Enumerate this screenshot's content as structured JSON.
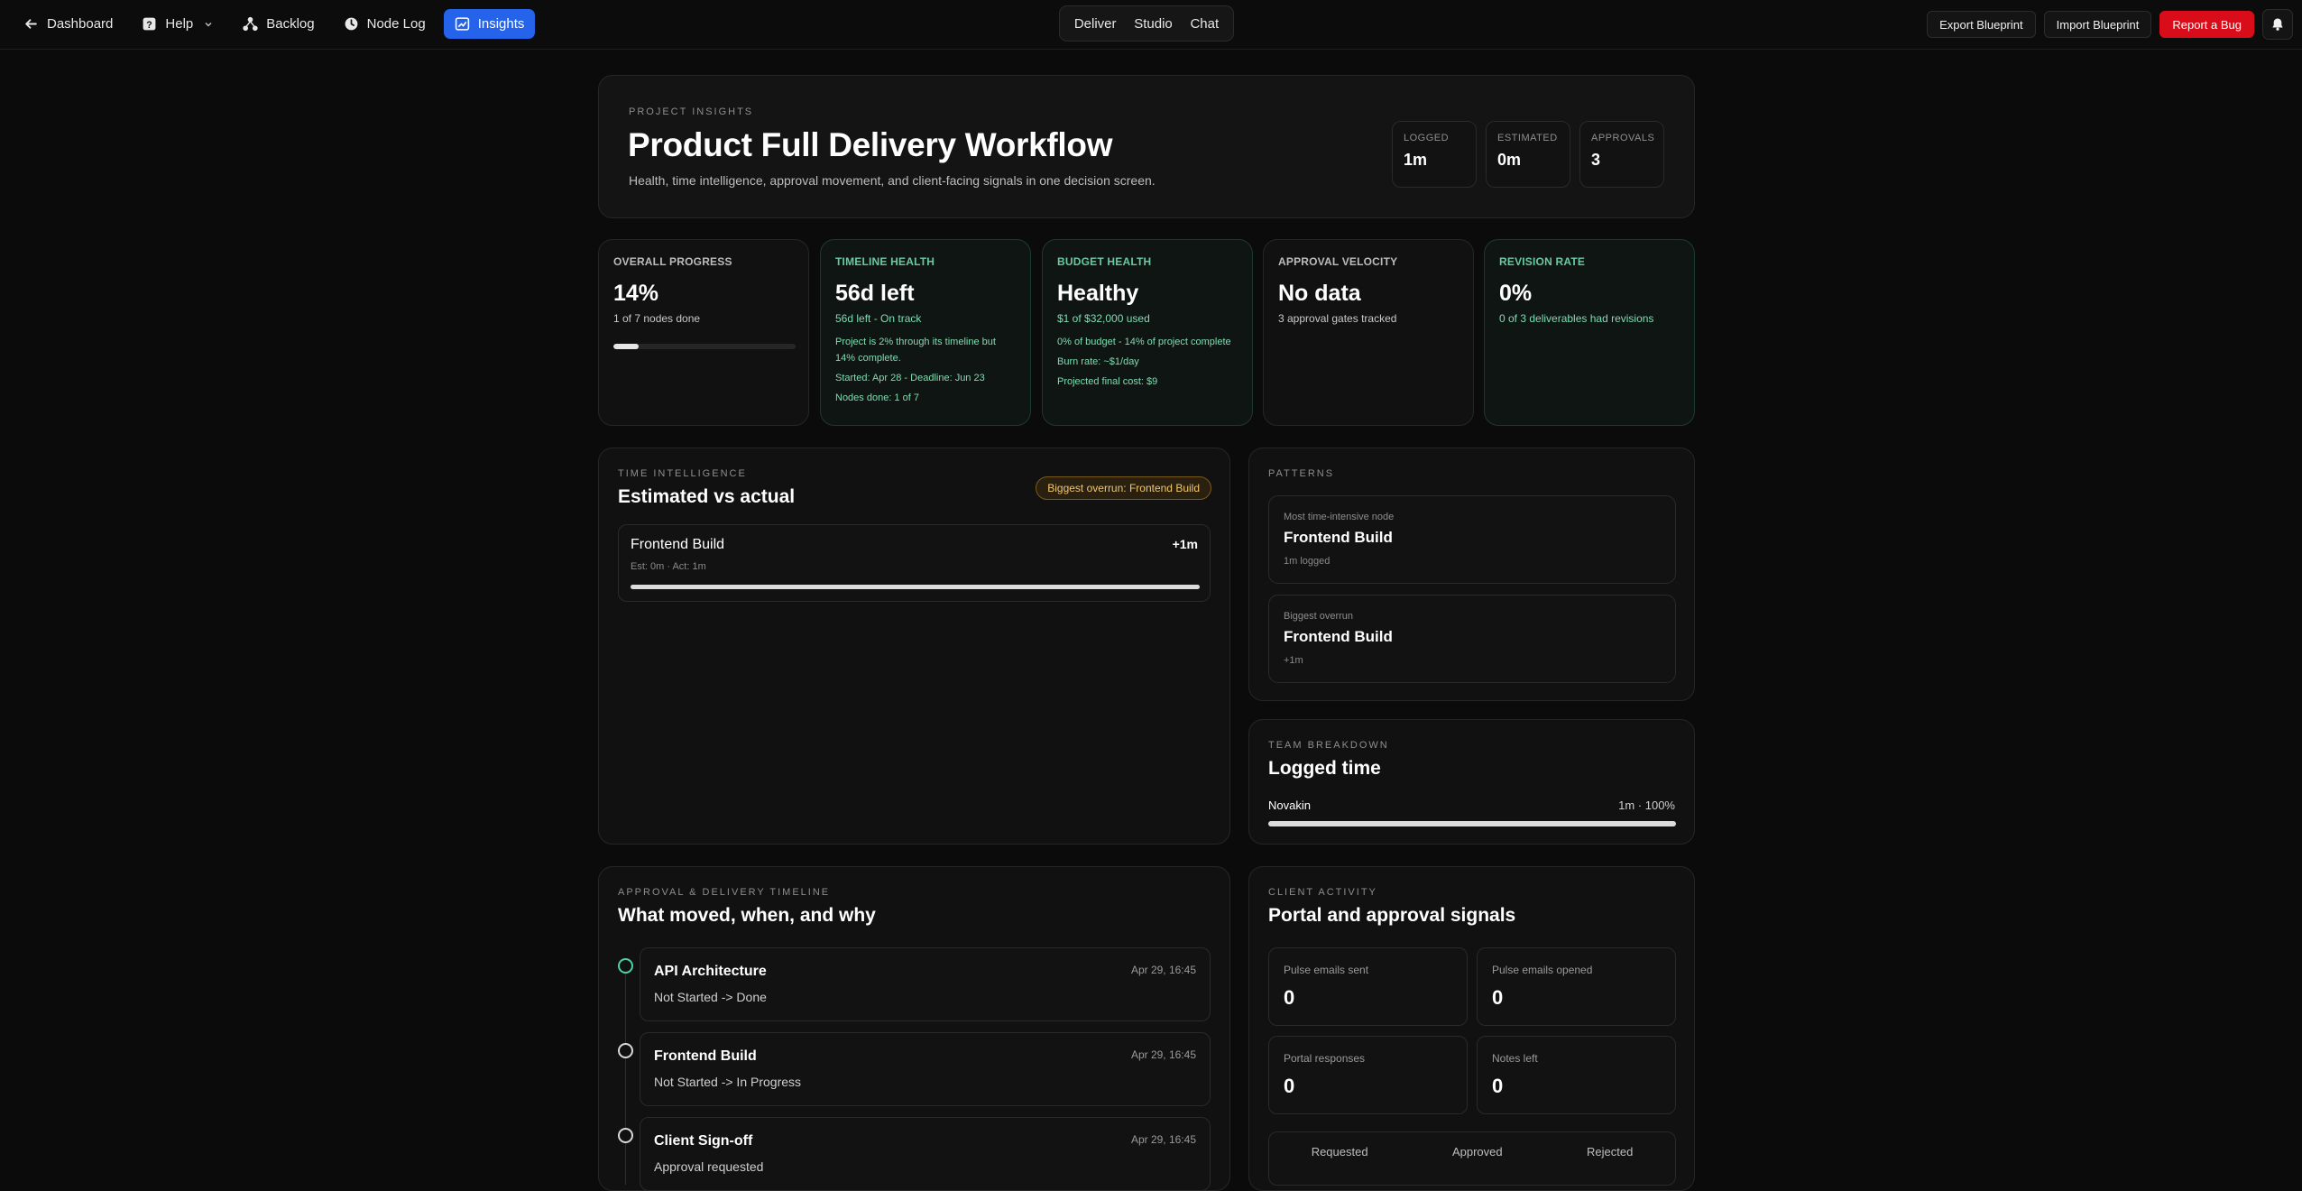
{
  "nav": {
    "dashboard": "Dashboard",
    "help": "Help",
    "backlog": "Backlog",
    "node_log": "Node Log",
    "insights": "Insights",
    "segments": [
      "Deliver",
      "Studio",
      "Chat"
    ],
    "export": "Export Blueprint",
    "import": "Import Blueprint",
    "report_bug": "Report a Bug"
  },
  "hero": {
    "eyebrow": "PROJECT INSIGHTS",
    "title": "Product Full Delivery Workflow",
    "description": "Health, time intelligence, approval movement, and client-facing signals in one decision screen.",
    "stats": [
      {
        "label": "LOGGED",
        "value": "1m"
      },
      {
        "label": "ESTIMATED",
        "value": "0m"
      },
      {
        "label": "APPROVALS",
        "value": "3"
      }
    ]
  },
  "kpis": {
    "progress": {
      "label": "OVERALL PROGRESS",
      "value": "14%",
      "sub": "1 of 7 nodes done",
      "fraction": 0.14
    },
    "timeline": {
      "label": "TIMELINE HEALTH",
      "value": "56d left",
      "sub": "56d left - On track",
      "notes": [
        "Project is 2% through its timeline but 14% complete.",
        "Started: Apr 28 - Deadline: Jun 23",
        "Nodes done: 1 of 7"
      ]
    },
    "budget": {
      "label": "BUDGET HEALTH",
      "value": "Healthy",
      "sub": "$1 of $32,000 used",
      "notes": [
        "0% of budget - 14% of project complete",
        "Burn rate: ~$1/day",
        "Projected final cost: $9"
      ]
    },
    "velocity": {
      "label": "APPROVAL VELOCITY",
      "value": "No data",
      "sub": "3 approval gates tracked"
    },
    "revision": {
      "label": "REVISION RATE",
      "value": "0%",
      "sub": "0 of 3 deliverables had revisions"
    }
  },
  "time": {
    "eyebrow": "TIME INTELLIGENCE",
    "title": "Estimated vs actual",
    "badge": "Biggest overrun: Frontend Build",
    "item": {
      "name": "Frontend Build",
      "delta": "+1m",
      "meta": "Est: 0m · Act: 1m",
      "fraction": 1.0
    }
  },
  "patterns": {
    "eyebrow": "PATTERNS",
    "cards": [
      {
        "label": "Most time-intensive node",
        "name": "Frontend Build",
        "note": "1m logged"
      },
      {
        "label": "Biggest overrun",
        "name": "Frontend Build",
        "note": "+1m"
      }
    ]
  },
  "team": {
    "eyebrow": "TEAM BREAKDOWN",
    "title": "Logged time",
    "member": "Novakin",
    "value": "1m · 100%",
    "fraction": 1.0
  },
  "approval": {
    "eyebrow": "APPROVAL & DELIVERY TIMELINE",
    "title": "What moved, when, and why",
    "items": [
      {
        "name": "API Architecture",
        "status": "Not Started -> Done",
        "date": "Apr 29, 16:45"
      },
      {
        "name": "Frontend Build",
        "status": "Not Started -> In Progress",
        "date": "Apr 29, 16:45"
      },
      {
        "name": "Client Sign-off",
        "status": "Approval requested",
        "date": "Apr 29, 16:45"
      }
    ]
  },
  "client": {
    "eyebrow": "CLIENT ACTIVITY",
    "title": "Portal and approval signals",
    "cards": [
      {
        "label": "Pulse emails sent",
        "value": "0"
      },
      {
        "label": "Pulse emails opened",
        "value": "0"
      },
      {
        "label": "Portal responses",
        "value": "0"
      },
      {
        "label": "Notes left",
        "value": "0"
      }
    ],
    "columns": [
      "Requested",
      "Approved",
      "Rejected"
    ]
  },
  "colors": {
    "accent": "#2563eb",
    "bug": "#d90d1a",
    "green": "#4fd1a1",
    "amber": "#f2c66d"
  }
}
